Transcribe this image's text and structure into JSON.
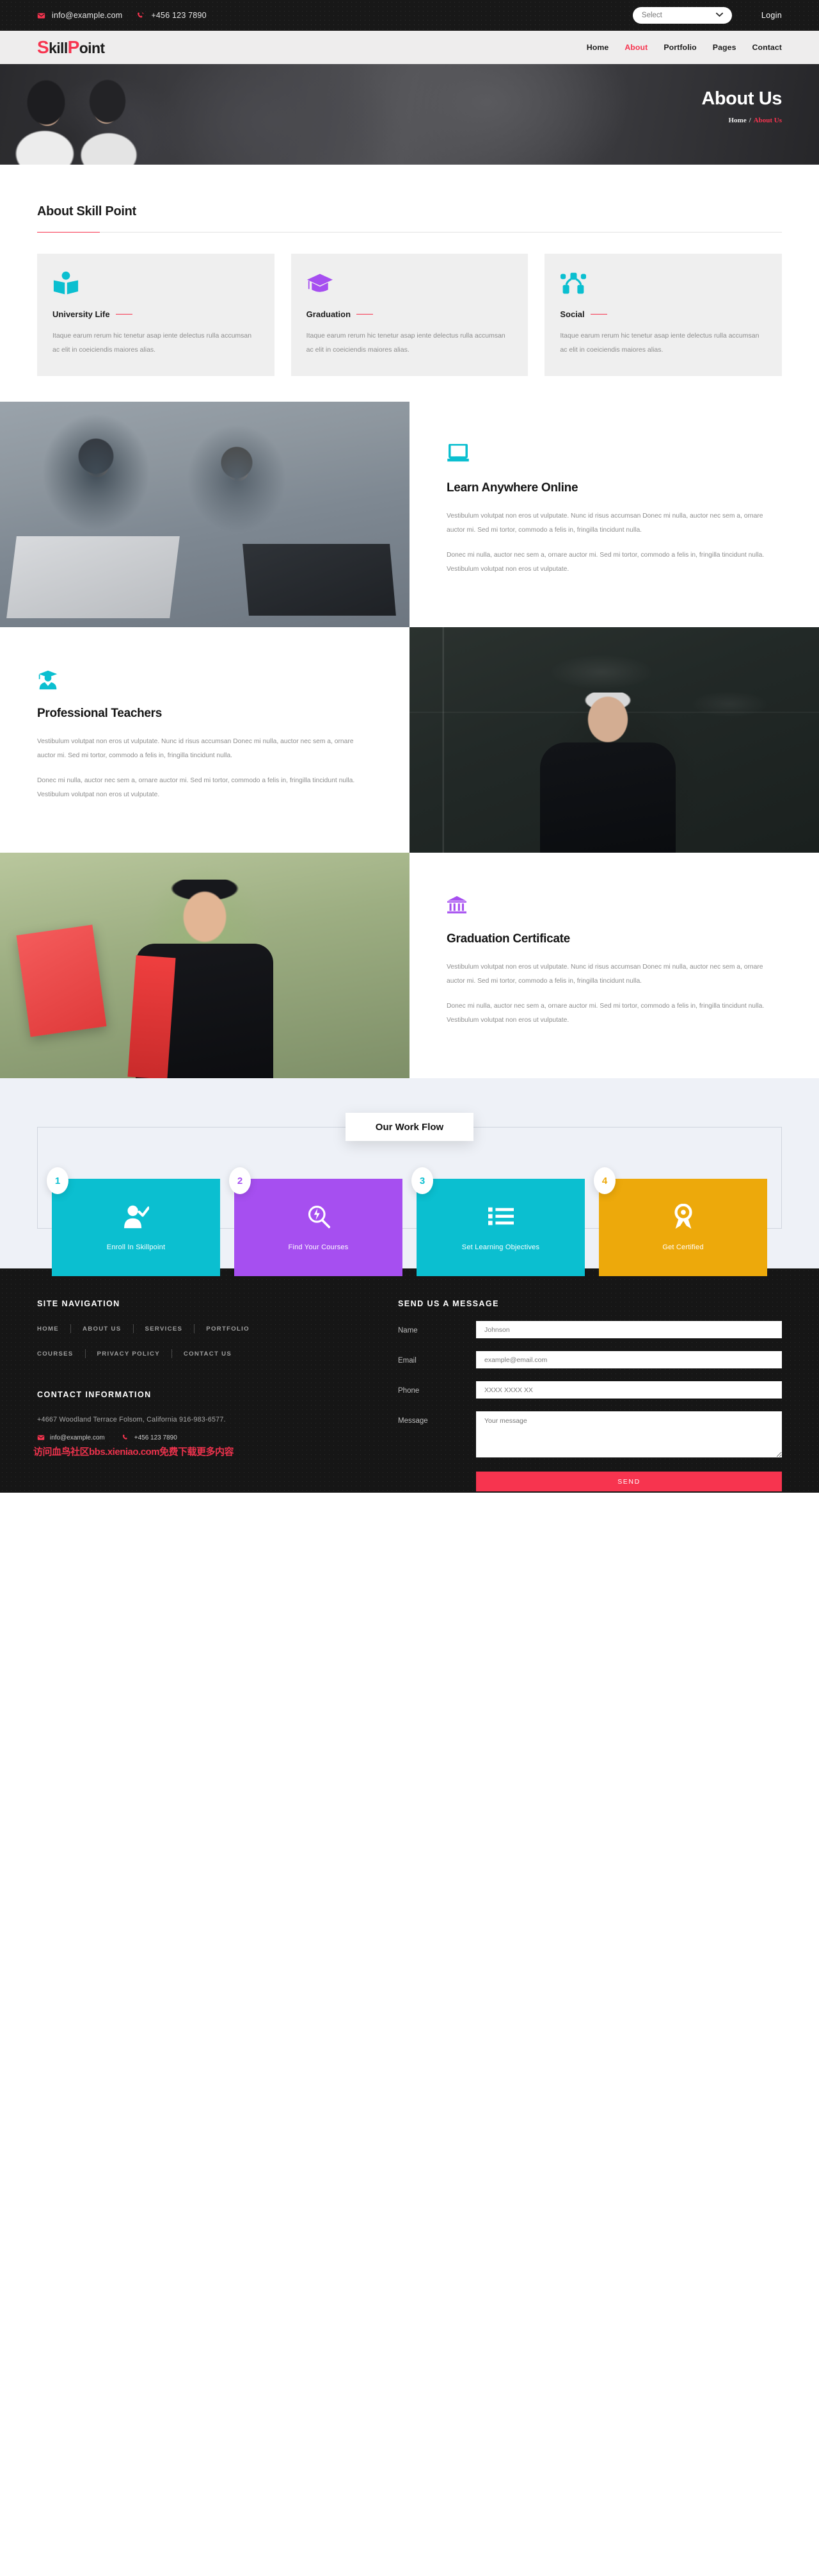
{
  "topbar": {
    "email": "info@example.com",
    "phone": "+456 123 7890",
    "select_placeholder": "Select",
    "login_label": "Login",
    "email_icon": "envelope-icon",
    "phone_icon": "phone-icon",
    "chevron": "▾"
  },
  "brand": {
    "first": "S",
    "rest1": "kill",
    "p": "P",
    "rest2": "oint"
  },
  "nav": {
    "items": [
      {
        "label": "Home",
        "active": false
      },
      {
        "label": "About",
        "active": true
      },
      {
        "label": "Portfolio",
        "active": false
      },
      {
        "label": "Pages",
        "active": false
      },
      {
        "label": "Contact",
        "active": false
      }
    ]
  },
  "hero": {
    "title": "About Us",
    "crumb_home": "Home",
    "crumb_sep": "/",
    "crumb_current": "About Us"
  },
  "about": {
    "heading": "About Skill Point",
    "cards": [
      {
        "icon": "open-book-reader-icon",
        "color": "#0bbfd0",
        "title": "University Life",
        "text": "Itaque earum rerum hic tenetur asap iente delectus rulla accumsan ac elit in coeiciendis maiores alias."
      },
      {
        "icon": "graduation-cap-icon",
        "color": "#a64ff0",
        "title": "Graduation",
        "text": "Itaque earum rerum hic tenetur asap iente delectus rulla accumsan ac elit in coeiciendis maiores alias."
      },
      {
        "icon": "social-network-icon",
        "color": "#0bbfd0",
        "title": "Social",
        "text": "Itaque earum rerum hic tenetur asap iente delectus rulla accumsan ac elit in coeiciendis maiores alias."
      }
    ]
  },
  "features": [
    {
      "icon": "laptop-icon",
      "title": "Learn Anywhere Online",
      "p1": "Vestibulum volutpat non eros ut vulputate. Nunc id risus accumsan Donec mi nulla, auctor nec sem a, ornare auctor mi. Sed mi tortor, commodo a felis in, fringilla tincidunt nulla.",
      "p2": "Donec mi nulla, auctor nec sem a, ornare auctor mi. Sed mi tortor, commodo a felis in, fringilla tincidunt nulla. Vestibulum volutpat non eros ut vulputate.",
      "media_alt": "two-students-with-laptops-photo"
    },
    {
      "icon": "teacher-graduate-icon",
      "title": "Professional Teachers",
      "p1": "Vestibulum volutpat non eros ut vulputate. Nunc id risus accumsan Donec mi nulla, auctor nec sem a, ornare auctor mi. Sed mi tortor, commodo a felis in, fringilla tincidunt nulla.",
      "p2": "Donec mi nulla, auctor nec sem a, ornare auctor mi. Sed mi tortor, commodo a felis in, fringilla tincidunt nulla. Vestibulum volutpat non eros ut vulputate.",
      "media_alt": "professor-at-blackboard-photo"
    },
    {
      "icon": "certificate-bank-icon",
      "title": "Graduation Certificate",
      "p1": "Vestibulum volutpat non eros ut vulputate. Nunc id risus accumsan Donec mi nulla, auctor nec sem a, ornare auctor mi. Sed mi tortor, commodo a felis in, fringilla tincidunt nulla.",
      "p2": "Donec mi nulla, auctor nec sem a, ornare auctor mi. Sed mi tortor, commodo a felis in, fringilla tincidunt nulla. Vestibulum volutpat non eros ut vulputate.",
      "media_alt": "graduate-with-certificate-photo"
    }
  ],
  "workflow": {
    "badge": "Our Work Flow",
    "steps": [
      {
        "num": "1",
        "label": "Enroll In Skillpoint",
        "color": "#0bbfd0",
        "num_color": "#0bbfd0",
        "icon": "user-check-icon"
      },
      {
        "num": "2",
        "label": "Find Your Courses",
        "color": "#a64ff0",
        "num_color": "#a64ff0",
        "icon": "search-bolt-icon"
      },
      {
        "num": "3",
        "label": "Set Learning Objectives",
        "color": "#0bbfd0",
        "num_color": "#0bbfd0",
        "icon": "list-icon"
      },
      {
        "num": "4",
        "label": "Get Certified",
        "color": "#eda90b",
        "num_color": "#eda90b",
        "icon": "award-icon"
      }
    ]
  },
  "footer": {
    "nav_heading": "SITE NAVIGATION",
    "links_row1": [
      "HOME",
      "ABOUT US",
      "SERVICES",
      "PORTFOLIO"
    ],
    "links_row2": [
      "COURSES",
      "PRIVACY POLICY",
      "CONTACT US"
    ],
    "contact_heading": "CONTACT INFORMATION",
    "address": "+4667 Woodland Terrace Folsom, California 916-983-6577.",
    "email": "info@example.com",
    "phone": "+456 123 7890",
    "form_heading": "SEND US A MESSAGE",
    "fields": [
      {
        "label": "Name",
        "value": "Johnson",
        "name": "name-field"
      },
      {
        "label": "Email",
        "value": "example@email.com",
        "name": "email-field"
      },
      {
        "label": "Phone",
        "value": "XXXX XXXX XX",
        "name": "phone-field"
      },
      {
        "label": "Message",
        "value": "Your message",
        "name": "message-field"
      }
    ],
    "send_label": "SEND",
    "watermark": "访问血鸟社区bbs.xieniao.com免费下载更多内容"
  },
  "colors": {
    "accent": "#f7344f",
    "cyan": "#0bbfd0",
    "purple": "#a64ff0",
    "amber": "#eda90b"
  }
}
